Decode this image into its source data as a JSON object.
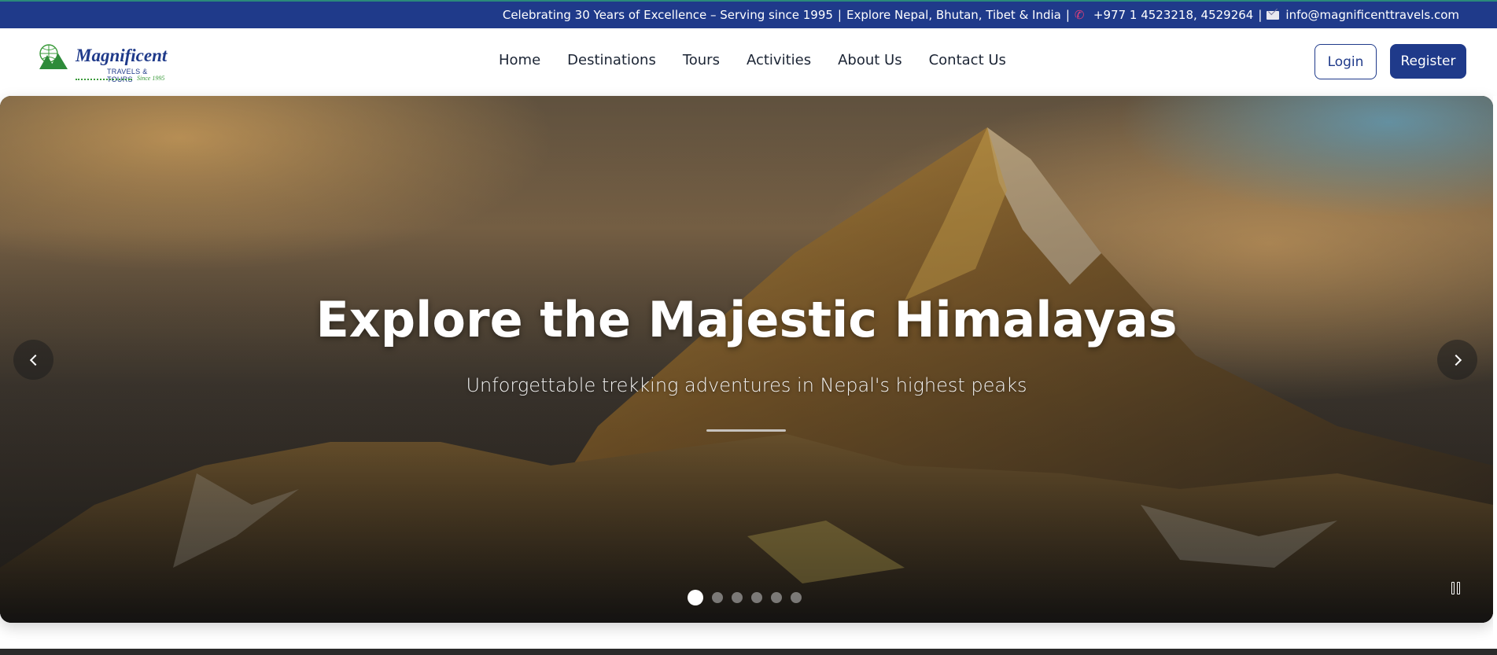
{
  "topbar": {
    "announcement": "Celebrating 30 Years of Excellence – Serving since 1995",
    "explore": "Explore Nepal, Bhutan, Tibet & India",
    "phone": "+977 1 4523218, 4529264",
    "email": "info@magnificenttravels.com",
    "separator": "|",
    "phone_icon": "phone-icon",
    "mail_icon": "mail-icon",
    "background": "#1f3a8a"
  },
  "header": {
    "logo": {
      "title": "Magnificent",
      "subtitle": "TRAVELS & TOURS",
      "since": "Since 1995"
    },
    "nav": [
      {
        "label": "Home"
      },
      {
        "label": "Destinations"
      },
      {
        "label": "Tours"
      },
      {
        "label": "Activities"
      },
      {
        "label": "About Us"
      },
      {
        "label": "Contact Us"
      }
    ],
    "login_label": "Login",
    "register_label": "Register",
    "accent": "#1f3a8a"
  },
  "hero": {
    "title": "Explore the Majestic Himalayas",
    "subtitle": "Unforgettable trekking adventures in Nepal's highest peaks",
    "slides_total": 6,
    "active_slide": 1,
    "prev_icon": "chevron-left-icon",
    "next_icon": "chevron-right-icon",
    "pause_icon": "pause-icon"
  }
}
